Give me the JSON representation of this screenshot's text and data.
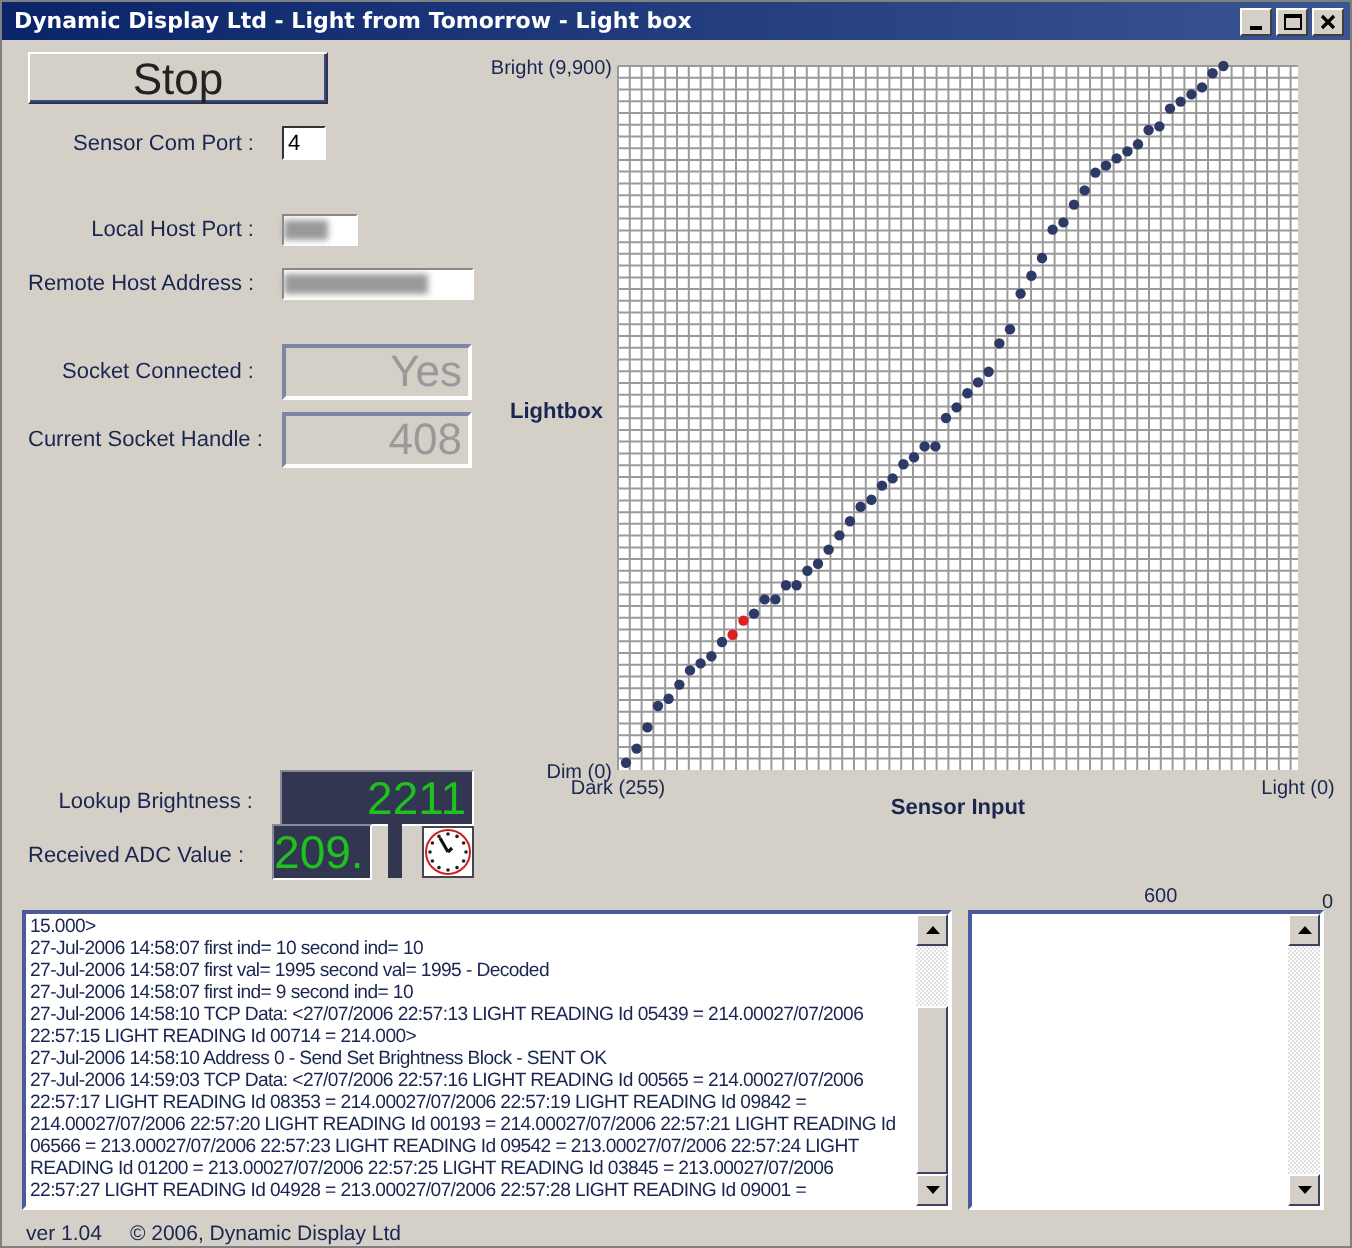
{
  "window": {
    "title": "Dynamic Display Ltd - Light from Tomorrow - Light box"
  },
  "stop_button": {
    "label": "Stop"
  },
  "settings": [
    {
      "kind": "input",
      "label": "Sensor Com Port :",
      "value": "4"
    },
    {
      "kind": "masked",
      "label": "Local Host Port :"
    },
    {
      "kind": "masked-wide",
      "label": "Remote Host Address :"
    },
    {
      "kind": "readout",
      "label": "Socket Connected :",
      "value": "Yes"
    },
    {
      "kind": "readout",
      "label": "Current Socket Handle :",
      "value": "408"
    }
  ],
  "lookup_brightness": {
    "label": "Lookup Brightness :",
    "value": "2211"
  },
  "received_adc": {
    "label": "Received ADC Value :",
    "value": "209."
  },
  "chart": {
    "side_label": "Lightbox",
    "chart_data": {
      "type": "scatter",
      "xlabel": "Sensor Input",
      "xlim": [
        255,
        0
      ],
      "ylim": [
        0,
        9900
      ],
      "xticks": [
        {
          "value": 255,
          "label": "Dark (255)"
        },
        {
          "value": 0,
          "label": "Light (0)"
        }
      ],
      "yticks": [
        {
          "value": 9900,
          "label": "Bright (9,900)"
        },
        {
          "value": 0,
          "label": "Dim (0)"
        }
      ],
      "x": [
        252,
        248,
        244,
        240,
        236,
        232,
        228,
        224,
        220,
        216,
        212,
        208,
        204,
        200,
        196,
        192,
        188,
        184,
        180,
        176,
        172,
        168,
        164,
        160,
        156,
        152,
        148,
        144,
        140,
        136,
        132,
        128,
        124,
        120,
        116,
        112,
        108,
        104,
        100,
        96,
        92,
        88,
        84,
        80,
        76,
        72,
        68,
        64,
        60,
        56,
        52,
        48,
        44,
        40,
        36,
        32,
        28
      ],
      "series": [
        {
          "color": "#2e3a66",
          "values": [
            100,
            300,
            600,
            900,
            1000,
            1200,
            1400,
            1500,
            1600,
            1800,
            null,
            null,
            2200,
            2400,
            2400,
            2600,
            2600,
            2800,
            2900,
            3100,
            3300,
            3500,
            3700,
            3800,
            4000,
            4100,
            4300,
            4400,
            4550,
            4550,
            4950,
            5100,
            5300,
            5450,
            5600,
            6000,
            6200,
            6700,
            6950,
            7200,
            7600,
            7700,
            7950,
            8150,
            8400,
            8500,
            8600,
            8700,
            8800,
            9000,
            9050,
            9300,
            9400,
            9500,
            9600,
            9800,
            9900
          ]
        },
        {
          "color": "#e02020",
          "values": [
            null,
            null,
            null,
            null,
            null,
            null,
            null,
            null,
            null,
            null,
            1900,
            2100,
            null,
            null,
            null,
            null,
            null,
            null,
            null,
            null,
            null,
            null,
            null,
            null,
            null,
            null,
            null,
            null,
            null,
            null,
            null,
            null,
            null,
            null,
            null,
            null,
            null,
            null,
            null,
            null,
            null,
            null,
            null,
            null,
            null,
            null,
            null,
            null,
            null,
            null,
            null,
            null,
            null,
            null,
            null,
            null,
            null
          ]
        }
      ]
    }
  },
  "log": {
    "lines": [
      "15.000>",
      "27-Jul-2006 14:58:07 first ind= 10  second ind= 10",
      "27-Jul-2006 14:58:07 first val= 1995  second val= 1995 - Decoded",
      "27-Jul-2006 14:58:07 first ind= 9  second ind= 10",
      "27-Jul-2006 14:58:10 TCP Data: <27/07/2006 22:57:13 LIGHT READING Id 05439 = 214.00027/07/2006",
      "22:57:15 LIGHT READING Id 00714 = 214.000>",
      "27-Jul-2006 14:58:10 Address 0 - Send Set Brightness Block - SENT OK",
      "27-Jul-2006 14:59:03 TCP Data: <27/07/2006 22:57:16 LIGHT READING Id 00565 = 214.00027/07/2006",
      "22:57:17 LIGHT READING Id 08353 = 214.00027/07/2006 22:57:19 LIGHT READING Id 09842 =",
      "214.00027/07/2006 22:57:20 LIGHT READING Id 00193 = 214.00027/07/2006 22:57:21 LIGHT READING Id",
      "06566 = 213.00027/07/2006 22:57:23 LIGHT READING Id 09542 = 213.00027/07/2006 22:57:24 LIGHT",
      "READING Id 01200 = 213.00027/07/2006 22:57:25 LIGHT READING Id 03845 = 213.00027/07/2006",
      "22:57:27 LIGHT READING Id 04928 = 213.00027/07/2006 22:57:28 LIGHT READING Id 09001 ="
    ]
  },
  "side_panel": {
    "scale_max": "600",
    "scale_min": "0"
  },
  "status_bar": {
    "version": "ver 1.04",
    "copyright": "© 2006, Dynamic Display Ltd"
  }
}
